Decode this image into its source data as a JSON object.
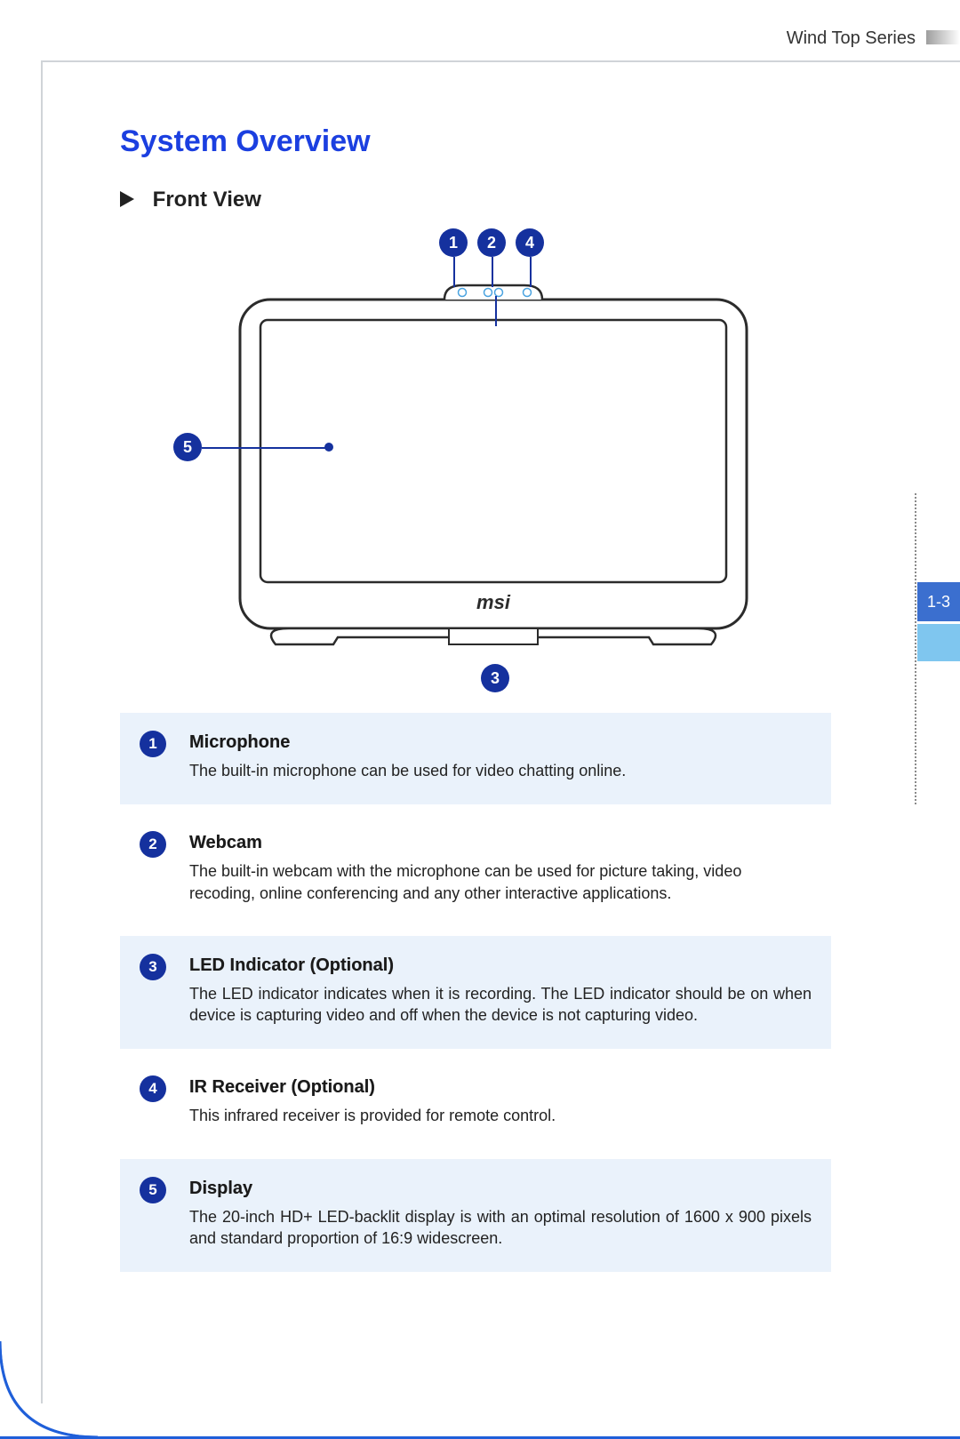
{
  "header": {
    "series": "Wind Top Series"
  },
  "page": {
    "title": "System Overview",
    "section": "Front View",
    "page_number": "1-3",
    "brand_on_device": "msi"
  },
  "diagram_callouts": {
    "c1": "1",
    "c2": "2",
    "c3": "3",
    "c4": "4",
    "c5": "5"
  },
  "features": [
    {
      "num": "1",
      "title": "Microphone",
      "desc": "The built-in microphone can be used for video chatting online.",
      "tint": true,
      "justify": false
    },
    {
      "num": "2",
      "title": "Webcam",
      "desc": "The built-in webcam with the microphone can be used for picture taking, video recoding, online conferencing and any other interactive applications.",
      "tint": false,
      "justify": false
    },
    {
      "num": "3",
      "title": "LED Indicator (Optional)",
      "desc": "The LED indicator indicates when it is recording. The LED indicator should be on when device is capturing video and off when the device is not capturing video.",
      "tint": true,
      "justify": true
    },
    {
      "num": "4",
      "title": "IR Receiver (Optional)",
      "desc": "This infrared receiver is provided for remote control.",
      "tint": false,
      "justify": false
    },
    {
      "num": "5",
      "title": "Display",
      "desc": "The 20-inch HD+ LED-backlit display is with an optimal resolution of 1600 x 900 pixels and standard proportion of 16:9 widescreen.",
      "tint": true,
      "justify": true
    }
  ]
}
